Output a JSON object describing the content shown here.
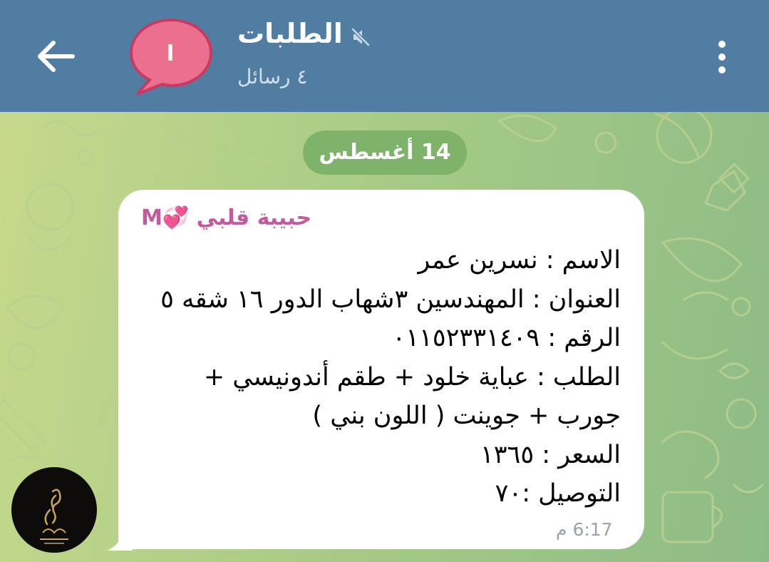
{
  "header": {
    "title": "الطلبات",
    "subtitle": "٤ رسائل",
    "avatar_letter": "ا",
    "back_icon": "arrow-left-icon",
    "mute_icon": "muted-speaker-icon",
    "menu_icon": "vertical-dots-icon"
  },
  "date_chip": "14 أغسطس",
  "message": {
    "sender": "حبيبة قلبي 💞M",
    "lines": [
      "الاسم : نسرين عمر",
      "العنوان : المهندسين ٣شهاب الدور ١٦ شقه ٥",
      "الرقم : ٠١١٥٢٣٣١٤٠٩",
      "الطلب : عباية خلود + طقم أندونيسي +",
      "جورب + جوينت ( اللون بني )",
      "السعر :  ١٣٦٥",
      "التوصيل :٧٠"
    ],
    "time": "6:17 م"
  },
  "user_avatar": {
    "logo_text": "عفة"
  },
  "colors": {
    "header": "#517da2",
    "date_chip": "#7fb26a",
    "avatar_bubble": "#ec6f8f",
    "sender_name": "#c45a9e",
    "bubble": "#ffffff",
    "time": "#9aa3a9"
  }
}
